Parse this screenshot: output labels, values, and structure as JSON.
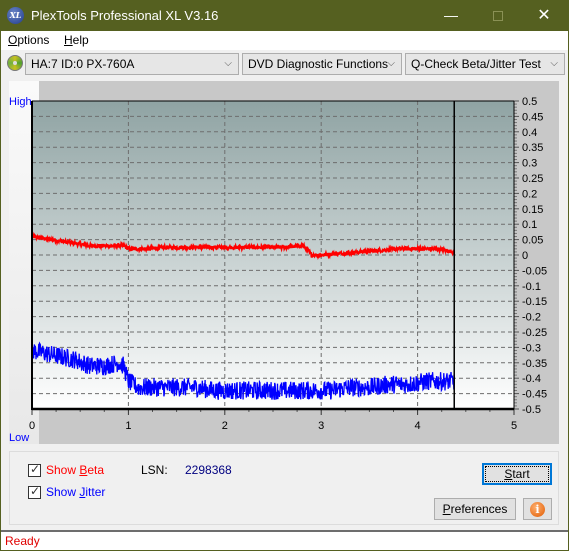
{
  "window": {
    "title": "PlexTools Professional XL V3.16",
    "app_icon_text": "XL",
    "minimize_icon": "minimize-icon",
    "maximize_icon": "maximize-icon",
    "close_icon": "close-icon",
    "close_glyph": "✕",
    "minimize_glyph": "—"
  },
  "menu": {
    "items": [
      {
        "label_underlined": "O",
        "label_rest": "ptions"
      },
      {
        "label_underlined": "H",
        "label_rest": "elp"
      }
    ]
  },
  "toolbar": {
    "drive_select": "HA:7 ID:0  PX-760A",
    "function_select": "DVD Diagnostic Functions",
    "test_select": "Q-Check Beta/Jitter Test",
    "chevron_glyph": "⌵"
  },
  "chart_data": {
    "type": "line",
    "title": "",
    "xlabel": "",
    "ylabel_left_top": "High",
    "ylabel_left_bottom": "Low",
    "xlim": [
      0,
      5
    ],
    "ylim": [
      -0.5,
      0.5
    ],
    "x_ticks": [
      "0",
      "1",
      "2",
      "3",
      "4",
      "5"
    ],
    "y_ticks_right": [
      "0.5",
      "0.45",
      "0.4",
      "0.35",
      "0.3",
      "0.25",
      "0.2",
      "0.15",
      "0.1",
      "0.05",
      "0",
      "-0.05",
      "-0.1",
      "-0.15",
      "-0.2",
      "-0.25",
      "-0.3",
      "-0.35",
      "-0.4",
      "-0.45",
      "-0.5"
    ],
    "grid": true,
    "marker_x": 4.38,
    "colors": {
      "beta": "#ff0000",
      "jitter": "#0000ff",
      "plot_top": "#8fa3a3",
      "plot_bottom": "#ffffff"
    },
    "series": [
      {
        "name": "Beta",
        "color": "#ff0000",
        "x": [
          0,
          0.2,
          0.4,
          0.6,
          0.8,
          0.95,
          1.0,
          1.2,
          1.4,
          1.6,
          1.8,
          2.0,
          2.2,
          2.4,
          2.6,
          2.8,
          2.85,
          2.9,
          3.0,
          3.2,
          3.4,
          3.6,
          3.8,
          4.0,
          4.2,
          4.38
        ],
        "y": [
          0.06,
          0.05,
          0.04,
          0.03,
          0.03,
          0.03,
          0.02,
          0.02,
          0.025,
          0.025,
          0.025,
          0.025,
          0.025,
          0.025,
          0.025,
          0.03,
          0.02,
          0.0,
          0.0,
          0.005,
          0.01,
          0.015,
          0.02,
          0.02,
          0.02,
          0.01
        ],
        "noise": 0.006
      },
      {
        "name": "Jitter",
        "color": "#0000ff",
        "x": [
          0,
          0.15,
          0.3,
          0.45,
          0.6,
          0.75,
          0.9,
          0.95,
          1.0,
          1.1,
          1.3,
          1.5,
          1.7,
          1.9,
          2.1,
          2.3,
          2.5,
          2.7,
          2.9,
          3.1,
          3.3,
          3.5,
          3.7,
          3.9,
          4.1,
          4.38
        ],
        "y": [
          -0.31,
          -0.32,
          -0.33,
          -0.34,
          -0.36,
          -0.36,
          -0.35,
          -0.36,
          -0.41,
          -0.43,
          -0.43,
          -0.43,
          -0.43,
          -0.44,
          -0.44,
          -0.44,
          -0.44,
          -0.44,
          -0.44,
          -0.44,
          -0.43,
          -0.43,
          -0.42,
          -0.42,
          -0.41,
          -0.41
        ],
        "noise": 0.03
      }
    ]
  },
  "options": {
    "show_beta_label_pre": "Show ",
    "show_beta_label_u": "B",
    "show_beta_label_post": "eta",
    "show_beta_checked": true,
    "show_jitter_label_pre": "Show ",
    "show_jitter_label_u": "J",
    "show_jitter_label_post": "itter",
    "show_jitter_checked": true,
    "lsn_label": "LSN:",
    "lsn_value": "2298368"
  },
  "buttons": {
    "start_u": "S",
    "start_rest": "tart",
    "preferences_u": "P",
    "preferences_rest": "references",
    "info_glyph": "i"
  },
  "status": {
    "text": "Ready"
  }
}
